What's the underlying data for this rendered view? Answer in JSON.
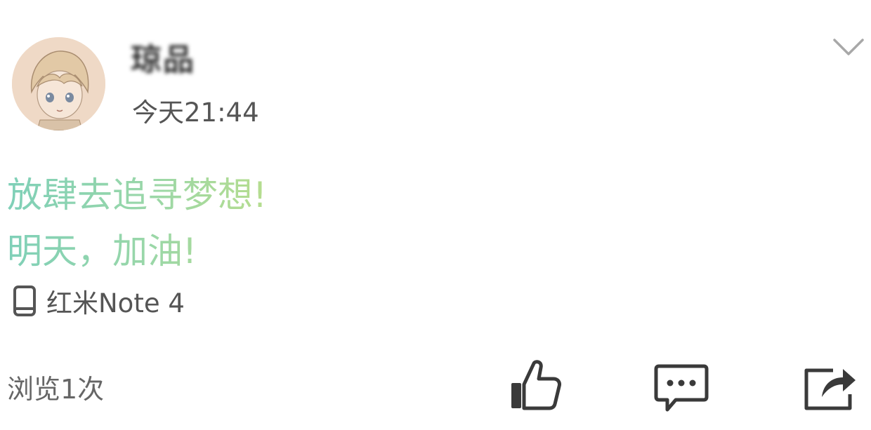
{
  "post": {
    "username": "琼品",
    "timestamp": "今天21:44",
    "content_lines": [
      "放肆去追寻梦想!",
      "明天，加油!"
    ],
    "device": "红米Note 4",
    "views": "浏览1次"
  },
  "icons": {
    "expand": "chevron-down-icon",
    "device": "phone-icon",
    "like": "thumbs-up-icon",
    "comment": "comment-icon",
    "share": "share-icon"
  },
  "colors": {
    "content_gradient_start": "#7fd0b8",
    "content_gradient_end": "#b6dd8e",
    "icon": "#3a3a3a",
    "secondary_text": "#555555"
  }
}
